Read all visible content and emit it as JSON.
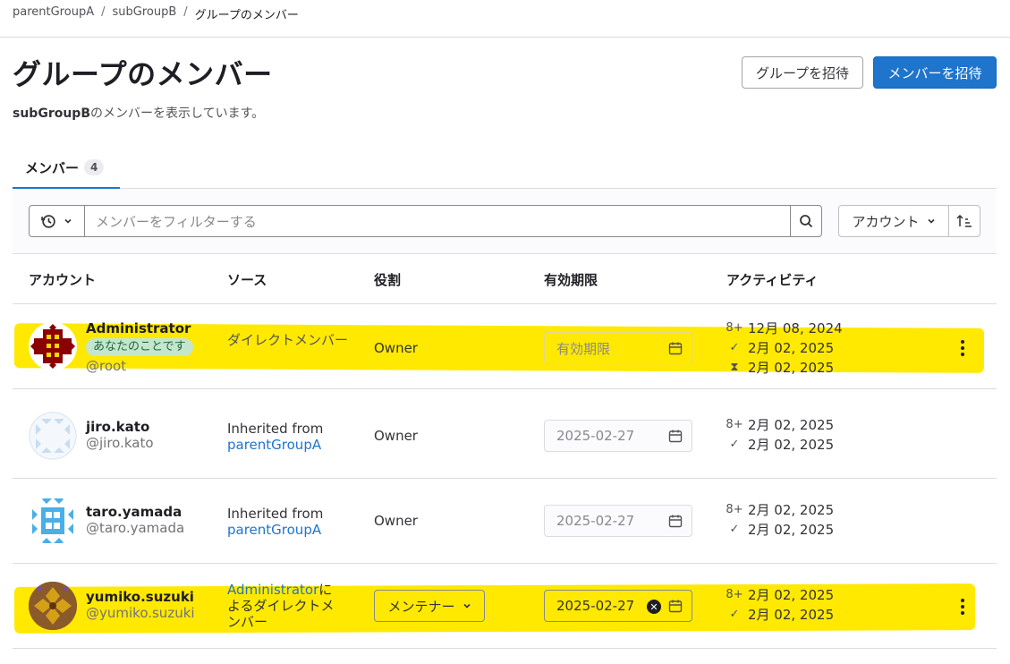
{
  "breadcrumb": {
    "items": [
      "parentGroupA",
      "subGroupB",
      "グループのメンバー"
    ]
  },
  "header": {
    "title": "グループのメンバー",
    "subtitle_group": "subGroupB",
    "subtitle_rest": "のメンバーを表示しています。",
    "invite_group_label": "グループを招待",
    "invite_member_label": "メンバーを招待"
  },
  "tabs": [
    {
      "label": "メンバー",
      "count": "4"
    }
  ],
  "filter": {
    "placeholder": "メンバーをフィルターする",
    "sort_label": "アカウント"
  },
  "table": {
    "columns": [
      "アカウント",
      "ソース",
      "役割",
      "有効期限",
      "アクティビティ"
    ],
    "rows": [
      {
        "name": "Administrator",
        "you_badge": "あなたのことです",
        "username": "@root",
        "source": "ダイレクトメンバー",
        "role": "Owner",
        "expiry": "有効期限",
        "activity": [
          "12月 08, 2024",
          "2月 02, 2025",
          "2月 02, 2025"
        ]
      },
      {
        "name": "jiro.kato",
        "username": "@jiro.kato",
        "source_prefix": "Inherited from",
        "source_link": "parentGroupA",
        "role": "Owner",
        "expiry": "2025-02-27",
        "activity": [
          "2月 02, 2025",
          "2月 02, 2025"
        ]
      },
      {
        "name": "taro.yamada",
        "username": "@taro.yamada",
        "source_prefix": "Inherited from",
        "source_link": "parentGroupA",
        "role": "Owner",
        "expiry": "2025-02-27",
        "activity": [
          "2月 02, 2025",
          "2月 02, 2025"
        ]
      },
      {
        "name": "yumiko.suzuki",
        "username": "@yumiko.suzuki",
        "source_link": "Administrator",
        "source_rest": "によるダイレクトメンバー",
        "role": "メンテナー",
        "expiry": "2025-02-27",
        "activity": [
          "2月 02, 2025",
          "2月 02, 2025"
        ]
      }
    ]
  },
  "colors": {
    "accent": "#1f75cb",
    "highlight": "#ffe900"
  }
}
